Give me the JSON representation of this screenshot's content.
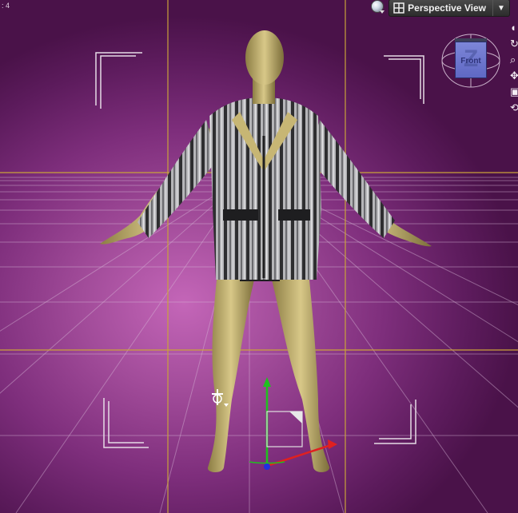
{
  "viewport": {
    "corner_label": ": 4",
    "view_selector": {
      "label": "Perspective View",
      "dropdown_icon": "triangle-down-icon",
      "icon": "view-layout-icon"
    },
    "sphere_button_icon": "shading-sphere-icon",
    "view_cube": {
      "face_label": "Front",
      "axis_letter": "Z"
    },
    "side_toolbar_icons": [
      "orbit-icon",
      "rotate-icon",
      "zoom-icon",
      "pan-icon",
      "frame-icon",
      "reset-icon",
      "camera-icon"
    ],
    "colors": {
      "background_center": "#c466b8",
      "background_edge": "#4a1249",
      "grid_line": "#d8b8d8",
      "guide_line": "#c9a23a",
      "figure_skin": "#c7b674",
      "jacket_dark": "#2e2e30",
      "jacket_light": "#b5b5b8",
      "axis_x": "#e02020",
      "axis_y": "#20c020",
      "axis_z": "#2030e0"
    }
  }
}
